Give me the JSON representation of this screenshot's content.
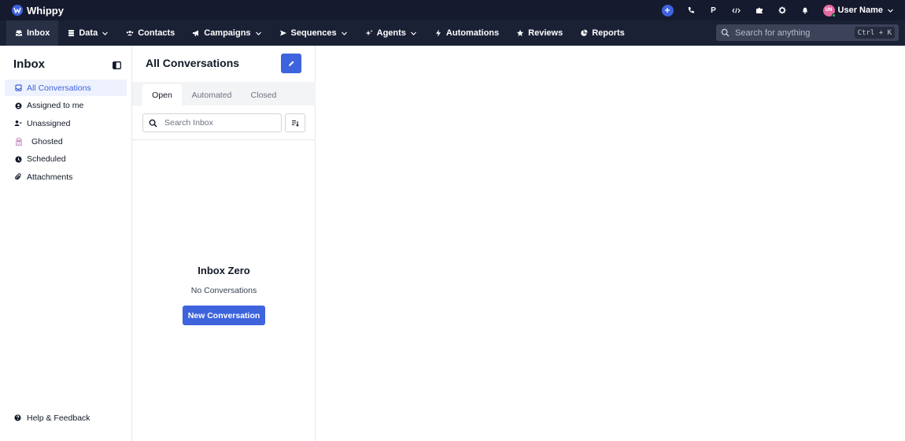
{
  "brand": {
    "name": "Whippy"
  },
  "user": {
    "name": "User Name",
    "initials": "UN"
  },
  "topbar_icons": [
    "plus-icon",
    "phone-icon",
    "p-icon",
    "code-icon",
    "puzzle-icon",
    "gear-icon",
    "bell-icon"
  ],
  "topbar_p_label": "P",
  "nav": {
    "items": [
      {
        "label": "Inbox",
        "icon": "inbox-icon",
        "dropdown": false,
        "active": true
      },
      {
        "label": "Data",
        "icon": "database-icon",
        "dropdown": true
      },
      {
        "label": "Contacts",
        "icon": "users-icon",
        "dropdown": false
      },
      {
        "label": "Campaigns",
        "icon": "megaphone-icon",
        "dropdown": true
      },
      {
        "label": "Sequences",
        "icon": "send-icon",
        "dropdown": true
      },
      {
        "label": "Agents",
        "icon": "sparkles-icon",
        "dropdown": true
      },
      {
        "label": "Automations",
        "icon": "bolt-icon",
        "dropdown": false
      },
      {
        "label": "Reviews",
        "icon": "star-icon",
        "dropdown": false
      },
      {
        "label": "Reports",
        "icon": "pie-chart-icon",
        "dropdown": false
      }
    ],
    "search_placeholder": "Search for anything",
    "search_shortcut": "Ctrl + K"
  },
  "sidebar": {
    "title": "Inbox",
    "items": [
      {
        "label": "All Conversations",
        "icon": "inbox-icon",
        "active": true
      },
      {
        "label": "Assigned to me",
        "icon": "user-circle-icon"
      },
      {
        "label": "Unassigned",
        "icon": "user-minus-icon"
      },
      {
        "label": "Ghosted",
        "icon": "ghost-icon"
      },
      {
        "label": "Scheduled",
        "icon": "clock-icon"
      },
      {
        "label": "Attachments",
        "icon": "paperclip-icon"
      }
    ],
    "help_label": "Help & Feedback"
  },
  "conversations": {
    "title": "All Conversations",
    "tabs": [
      {
        "label": "Open",
        "active": true
      },
      {
        "label": "Automated"
      },
      {
        "label": "Closed"
      }
    ],
    "search_placeholder": "Search Inbox",
    "empty_title": "Inbox Zero",
    "empty_subtitle": "No Conversations",
    "new_button_label": "New Conversation"
  },
  "colors": {
    "accent": "#3d63dd",
    "topbar_bg": "#151a2e",
    "navbar_bg": "#1b2135",
    "active_item_bg": "#eef2ff"
  }
}
